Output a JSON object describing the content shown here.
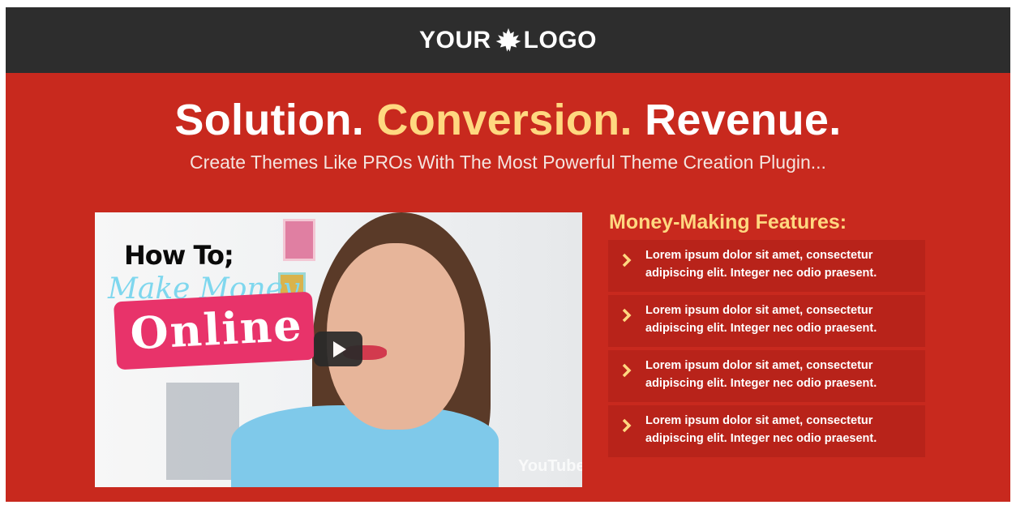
{
  "header": {
    "logo_left": "YOUR",
    "logo_icon": "maple-leaf-icon",
    "logo_right": "LOGO"
  },
  "hero": {
    "headline_part1": "Solution.",
    "headline_accent": "Conversion.",
    "headline_part2": "Revenue.",
    "subheadline": "Create Themes Like PROs With The Most Powerful Theme Creation Plugin..."
  },
  "video": {
    "title_line1": "How To;",
    "title_line2": "Make Money",
    "title_line3": "Online",
    "watermark": "YouTube",
    "play_icon": "play-icon"
  },
  "features": {
    "title": "Money-Making Features:",
    "items": [
      {
        "line1": "Lorem ipsum dolor sit amet, consectetur",
        "line2": "adipiscing elit. Integer nec odio praesent."
      },
      {
        "line1": "Lorem ipsum dolor sit amet, consectetur",
        "line2": "adipiscing elit. Integer nec odio praesent."
      },
      {
        "line1": "Lorem ipsum dolor sit amet, consectetur",
        "line2": "adipiscing elit. Integer nec odio praesent."
      },
      {
        "line1": "Lorem ipsum dolor sit amet, consectetur",
        "line2": "adipiscing elit. Integer nec odio praesent."
      }
    ]
  },
  "colors": {
    "header_bg": "#2d2d2d",
    "page_bg": "#c8291e",
    "accent": "#ffd880",
    "feature_bg": "#b8231a"
  }
}
